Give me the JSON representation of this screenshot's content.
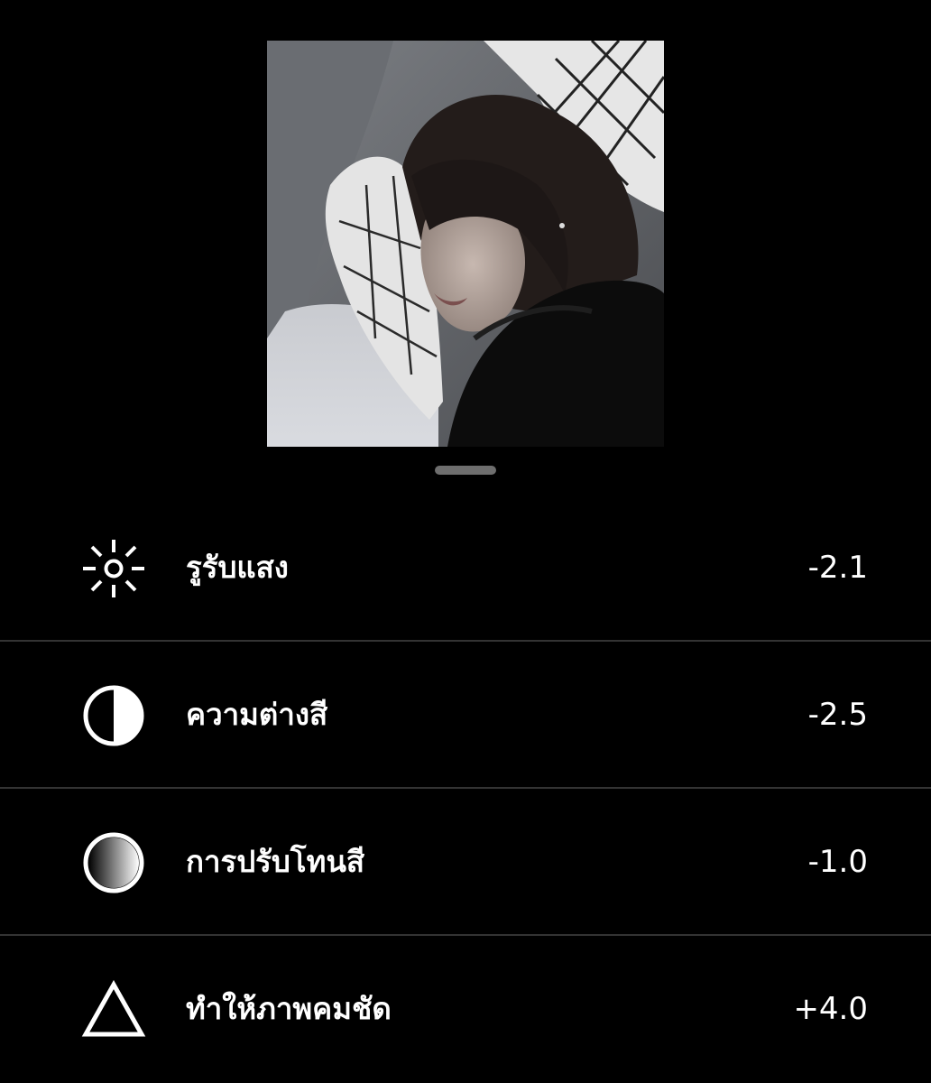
{
  "preview": {
    "image": "sleeping-girl-photo"
  },
  "adjustments": [
    {
      "icon": "sun-icon",
      "label": "รูรับแสง",
      "value": "-2.1"
    },
    {
      "icon": "contrast-icon",
      "label": "ความต่างสี",
      "value": "-2.5"
    },
    {
      "icon": "tone-gradient-icon",
      "label": "การปรับโทนสี",
      "value": "-1.0"
    },
    {
      "icon": "triangle-icon",
      "label": "ทำให้ภาพคมชัด",
      "value": "+4.0"
    }
  ],
  "colors": {
    "background": "#000000",
    "text": "#ffffff",
    "divider": "#333333",
    "handle": "#6e6e6e"
  }
}
